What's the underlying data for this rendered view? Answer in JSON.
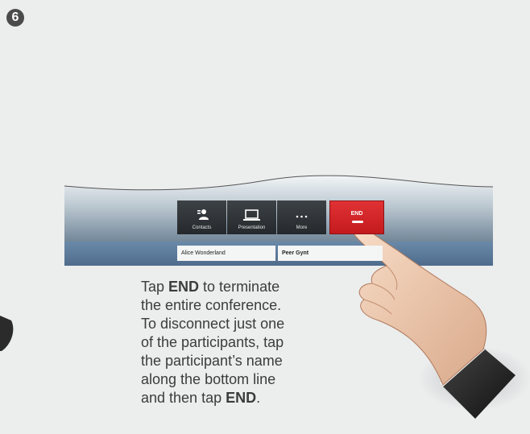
{
  "step": "6",
  "toolbar": {
    "contacts_label": "Contacts",
    "presentation_label": "Presentation",
    "more_label": "More",
    "end_label": "END"
  },
  "participants": [
    "Alice Wonderland",
    "Peer Gynt"
  ],
  "caption": {
    "line1_pre": "Tap ",
    "line1_bold": "END",
    "line1_post": " to terminate",
    "line2": "the entire conference.",
    "line3": "To disconnect just one",
    "line4": "of the participants, tap",
    "line5": "the participant’s name",
    "line6": "along the bottom line",
    "line7_pre": "and then tap ",
    "line7_bold": "END",
    "line7_post": "."
  },
  "colors": {
    "background": "#eceded",
    "end_button": "#d62427",
    "toolbar": "#2e3336",
    "screen": "#6f8395"
  }
}
